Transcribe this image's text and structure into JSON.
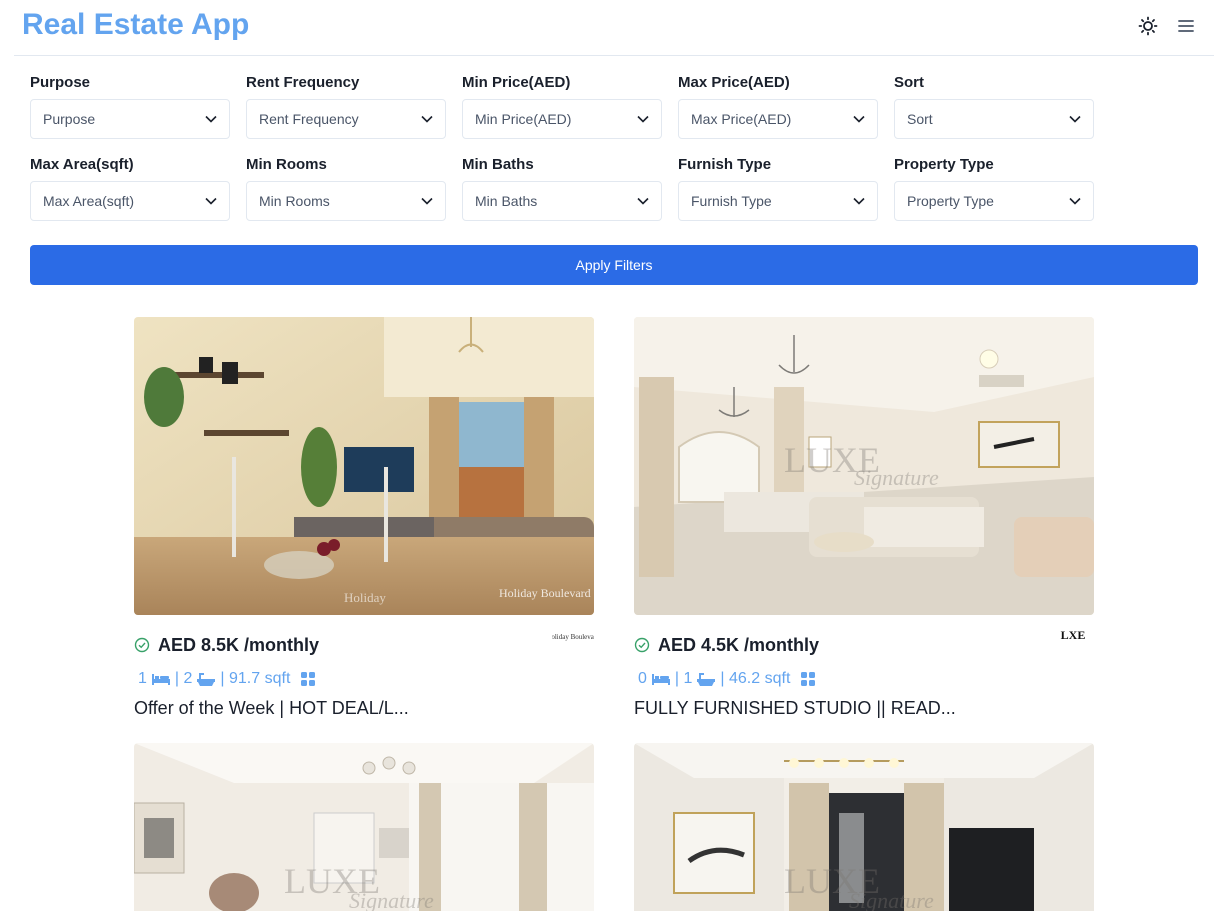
{
  "header": {
    "title": "Real Estate App",
    "theme_icon": "sun-icon",
    "menu_icon": "hamburger-menu-icon"
  },
  "filters": {
    "row1": [
      {
        "label": "Purpose",
        "placeholder": "Purpose"
      },
      {
        "label": "Rent Frequency",
        "placeholder": "Rent Frequency"
      },
      {
        "label": "Min Price(AED)",
        "placeholder": "Min Price(AED)"
      },
      {
        "label": "Max Price(AED)",
        "placeholder": "Max Price(AED)"
      },
      {
        "label": "Sort",
        "placeholder": "Sort"
      }
    ],
    "row2": [
      {
        "label": "Max Area(sqft)",
        "placeholder": "Max Area(sqft)"
      },
      {
        "label": "Min Rooms",
        "placeholder": "Min Rooms"
      },
      {
        "label": "Min Baths",
        "placeholder": "Min Baths"
      },
      {
        "label": "Furnish Type",
        "placeholder": "Furnish Type"
      },
      {
        "label": "Property Type",
        "placeholder": "Property Type"
      }
    ],
    "apply_label": "Apply Filters"
  },
  "properties": [
    {
      "price": "AED 8.5K /monthly",
      "rooms": "1",
      "baths": "| 2",
      "area": "| 91.7 sqft",
      "title": "Offer of the Week | HOT DEAL/L...",
      "watermark": "Holiday Boulevard",
      "agency_logo": "Holiday Boulevard"
    },
    {
      "price": "AED 4.5K /monthly",
      "rooms": "0",
      "baths": "| 1",
      "area": "| 46.2 sqft",
      "title": "FULLY FURNISHED STUDIO || READ...",
      "watermark": "LUXE Signature",
      "agency_logo": "LUXE Signature"
    },
    {
      "watermark": "LUXE Signature"
    },
    {
      "watermark": "LUXE Signature"
    }
  ],
  "colors": {
    "accent": "#63a4ef",
    "button": "#2b6be6",
    "verified": "#38a169"
  }
}
